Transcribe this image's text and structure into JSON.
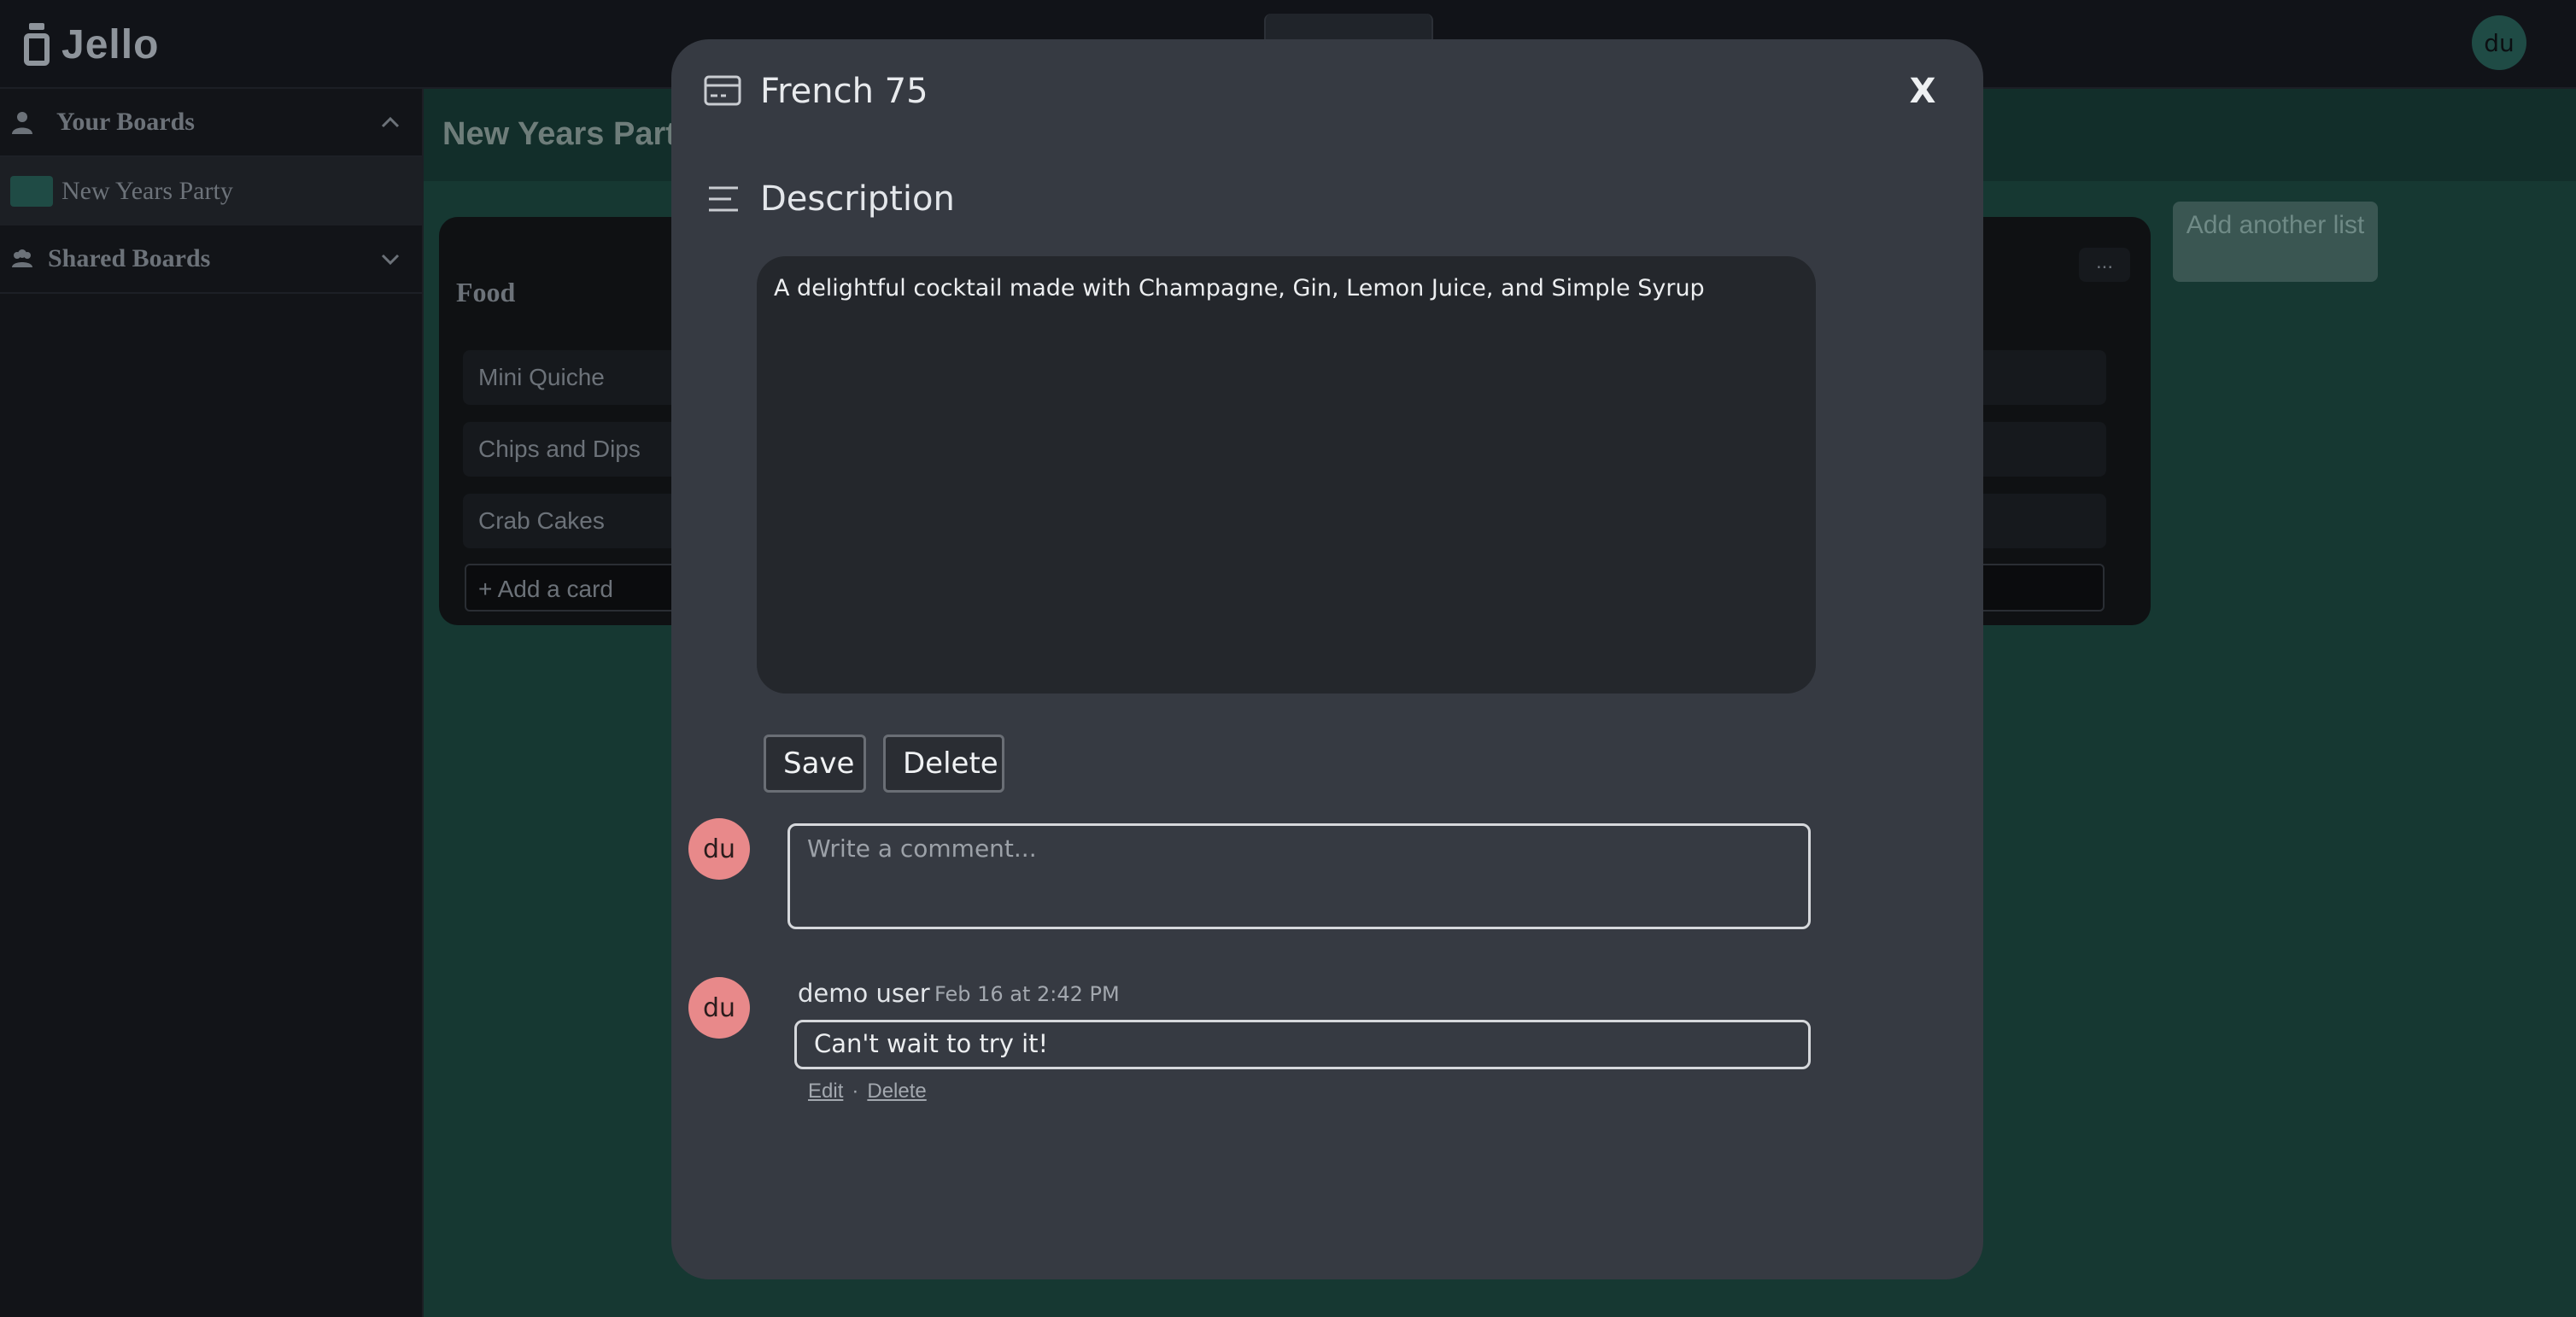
{
  "app": {
    "name": "Jello",
    "user_initials": "du"
  },
  "sidebar": {
    "your_boards_label": "Your Boards",
    "boards": [
      {
        "label": "New Years Party"
      }
    ],
    "shared_boards_label": "Shared Boards"
  },
  "board": {
    "title": "New Years Party",
    "add_list_label": "Add another list",
    "list": {
      "title": "Food",
      "menu_label": "...",
      "cards": [
        "Mini Quiche",
        "Chips and Dips",
        "Crab Cakes"
      ],
      "add_card_label": "+ Add a card"
    }
  },
  "modal": {
    "card_title": "French 75",
    "close_label": "X",
    "description_heading": "Description",
    "description_text": "A delightful cocktail made with Champagne, Gin, Lemon Juice, and Simple Syrup",
    "save_label": "Save",
    "delete_label": "Delete",
    "comment_placeholder": "Write a comment...",
    "commenter_initials": "du",
    "comments": [
      {
        "initials": "du",
        "author": "demo user",
        "time": "Feb 16 at 2:42 PM",
        "text": "Can't wait to try it!",
        "edit_label": "Edit",
        "separator": "·",
        "delete_label": "Delete"
      }
    ]
  },
  "colors": {
    "board_bg": "#163832",
    "modal_bg": "#363a42",
    "avatar_pink": "#e8898a",
    "avatar_teal": "#1f4b45"
  }
}
